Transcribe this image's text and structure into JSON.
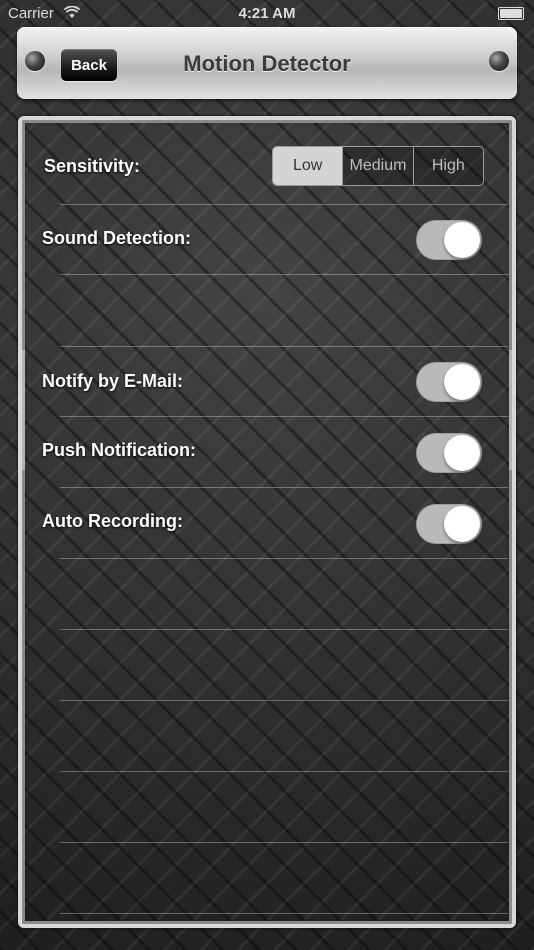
{
  "status_bar": {
    "carrier": "Carrier",
    "time": "4:21 AM"
  },
  "nav": {
    "back_label": "Back",
    "title": "Motion Detector"
  },
  "settings": {
    "sensitivity": {
      "label": "Sensitivity:",
      "options": [
        "Low",
        "Medium",
        "High"
      ],
      "selected": "Low"
    },
    "sound_detection": {
      "label": "Sound Detection:",
      "on": true
    },
    "notify_email": {
      "label": "Notify by E-Mail:",
      "on": true
    },
    "push_notification": {
      "label": "Push Notification:",
      "on": true
    },
    "auto_recording": {
      "label": "Auto Recording:",
      "on": true
    }
  },
  "colors": {
    "toggle_track": "#b9b9b9",
    "segment_selected": "#d4d4d4"
  }
}
